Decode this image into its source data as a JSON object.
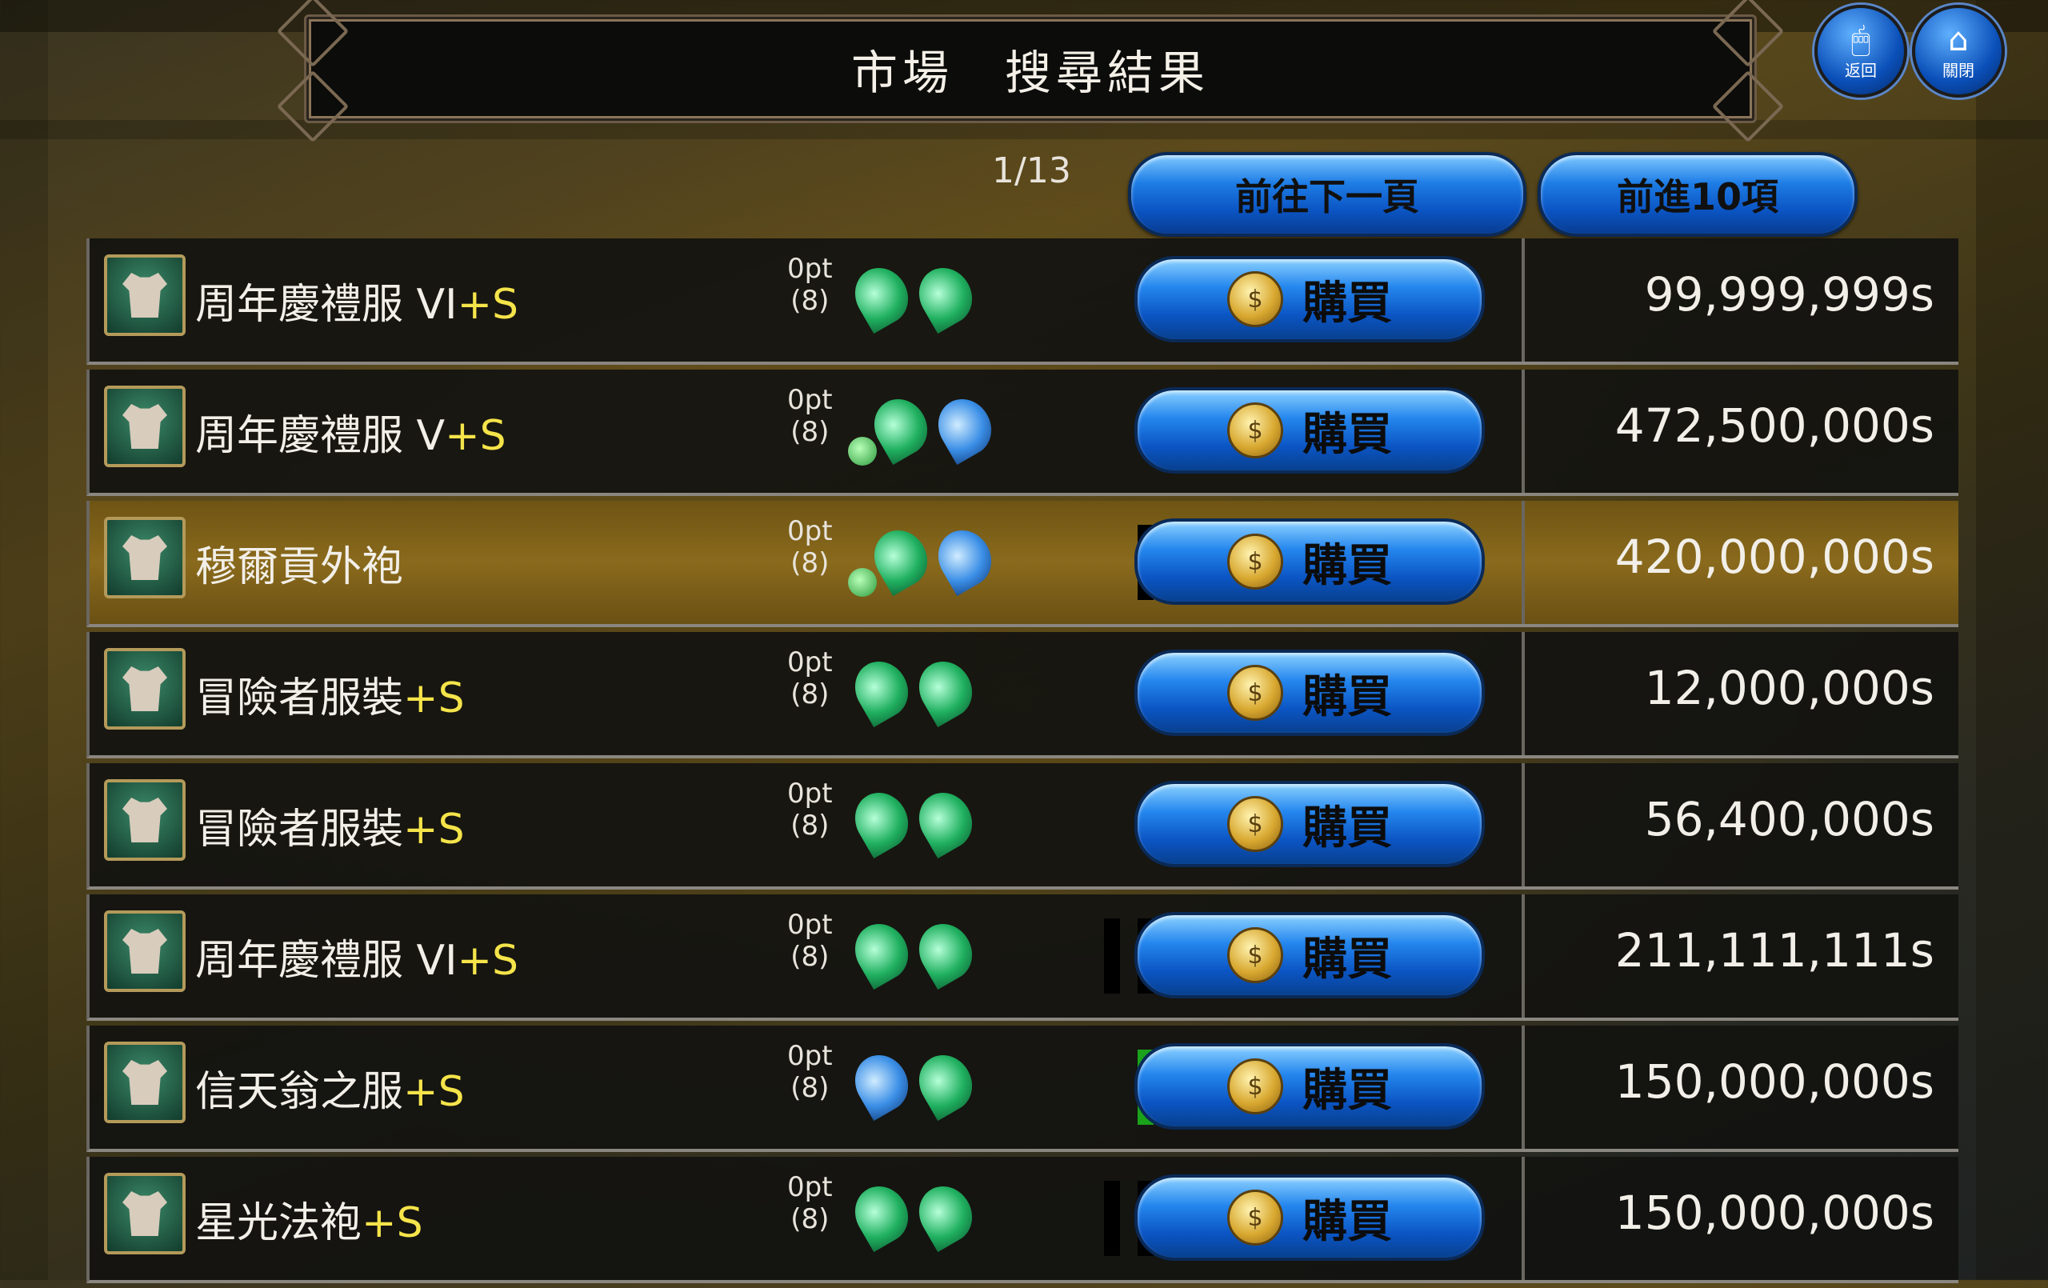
{
  "header": {
    "title": "市場　搜尋結果"
  },
  "top_buttons": [
    {
      "label": "返回",
      "icon": "mouse-icon"
    },
    {
      "label": "關閉",
      "icon": "house-icon"
    }
  ],
  "pager": {
    "text": "1/13",
    "next_page_label": "前往下一頁",
    "next10_label": "前進10項"
  },
  "buy_label": "購買",
  "rows": [
    {
      "name": "周年慶禮服 VI",
      "suffix": "+S",
      "opt_pt": "0pt",
      "opt_count": "(8)",
      "gems": [
        "green",
        "green"
      ],
      "dot": false,
      "bars": [],
      "price": "99,999,999s",
      "selected": false
    },
    {
      "name": "周年慶禮服 V",
      "suffix": "+S",
      "opt_pt": "0pt",
      "opt_count": "(8)",
      "gems": [
        "green",
        "blue"
      ],
      "dot": true,
      "bars": [
        "#ffffff"
      ],
      "price": "472,500,000s",
      "selected": false
    },
    {
      "name": "穆爾貢外袍",
      "suffix": "",
      "opt_pt": "0pt",
      "opt_count": "(8)",
      "gems": [
        "green",
        "blue"
      ],
      "dot": true,
      "bars": [
        "#000000",
        "#000000"
      ],
      "price": "420,000,000s",
      "selected": true
    },
    {
      "name": "冒險者服裝",
      "suffix": "+S",
      "opt_pt": "0pt",
      "opt_count": "(8)",
      "gems": [
        "green",
        "green"
      ],
      "dot": false,
      "bars": [],
      "price": "12,000,000s",
      "selected": false
    },
    {
      "name": "冒險者服裝",
      "suffix": "+S",
      "opt_pt": "0pt",
      "opt_count": "(8)",
      "gems": [
        "green",
        "green"
      ],
      "dot": false,
      "bars": [],
      "price": "56,400,000s",
      "selected": false
    },
    {
      "name": "周年慶禮服 VI",
      "suffix": "+S",
      "opt_pt": "0pt",
      "opt_count": "(8)",
      "gems": [
        "green",
        "green"
      ],
      "dot": false,
      "bars": [
        "#000000",
        "#000000",
        "#000000"
      ],
      "price": "211,111,111s",
      "selected": false
    },
    {
      "name": "信天翁之服",
      "suffix": "+S",
      "opt_pt": "0pt",
      "opt_count": "(8)",
      "gems": [
        "blue",
        "green"
      ],
      "dot": false,
      "bars": [
        "#1aa21a",
        "#3ad83a"
      ],
      "price": "150,000,000s",
      "selected": false
    },
    {
      "name": "星光法袍",
      "suffix": "+S",
      "opt_pt": "0pt",
      "opt_count": "(8)",
      "gems": [
        "green",
        "green"
      ],
      "dot": false,
      "bars": [
        "#000000",
        "#000000",
        "#000000"
      ],
      "price": "150,000,000s",
      "selected": false
    }
  ]
}
